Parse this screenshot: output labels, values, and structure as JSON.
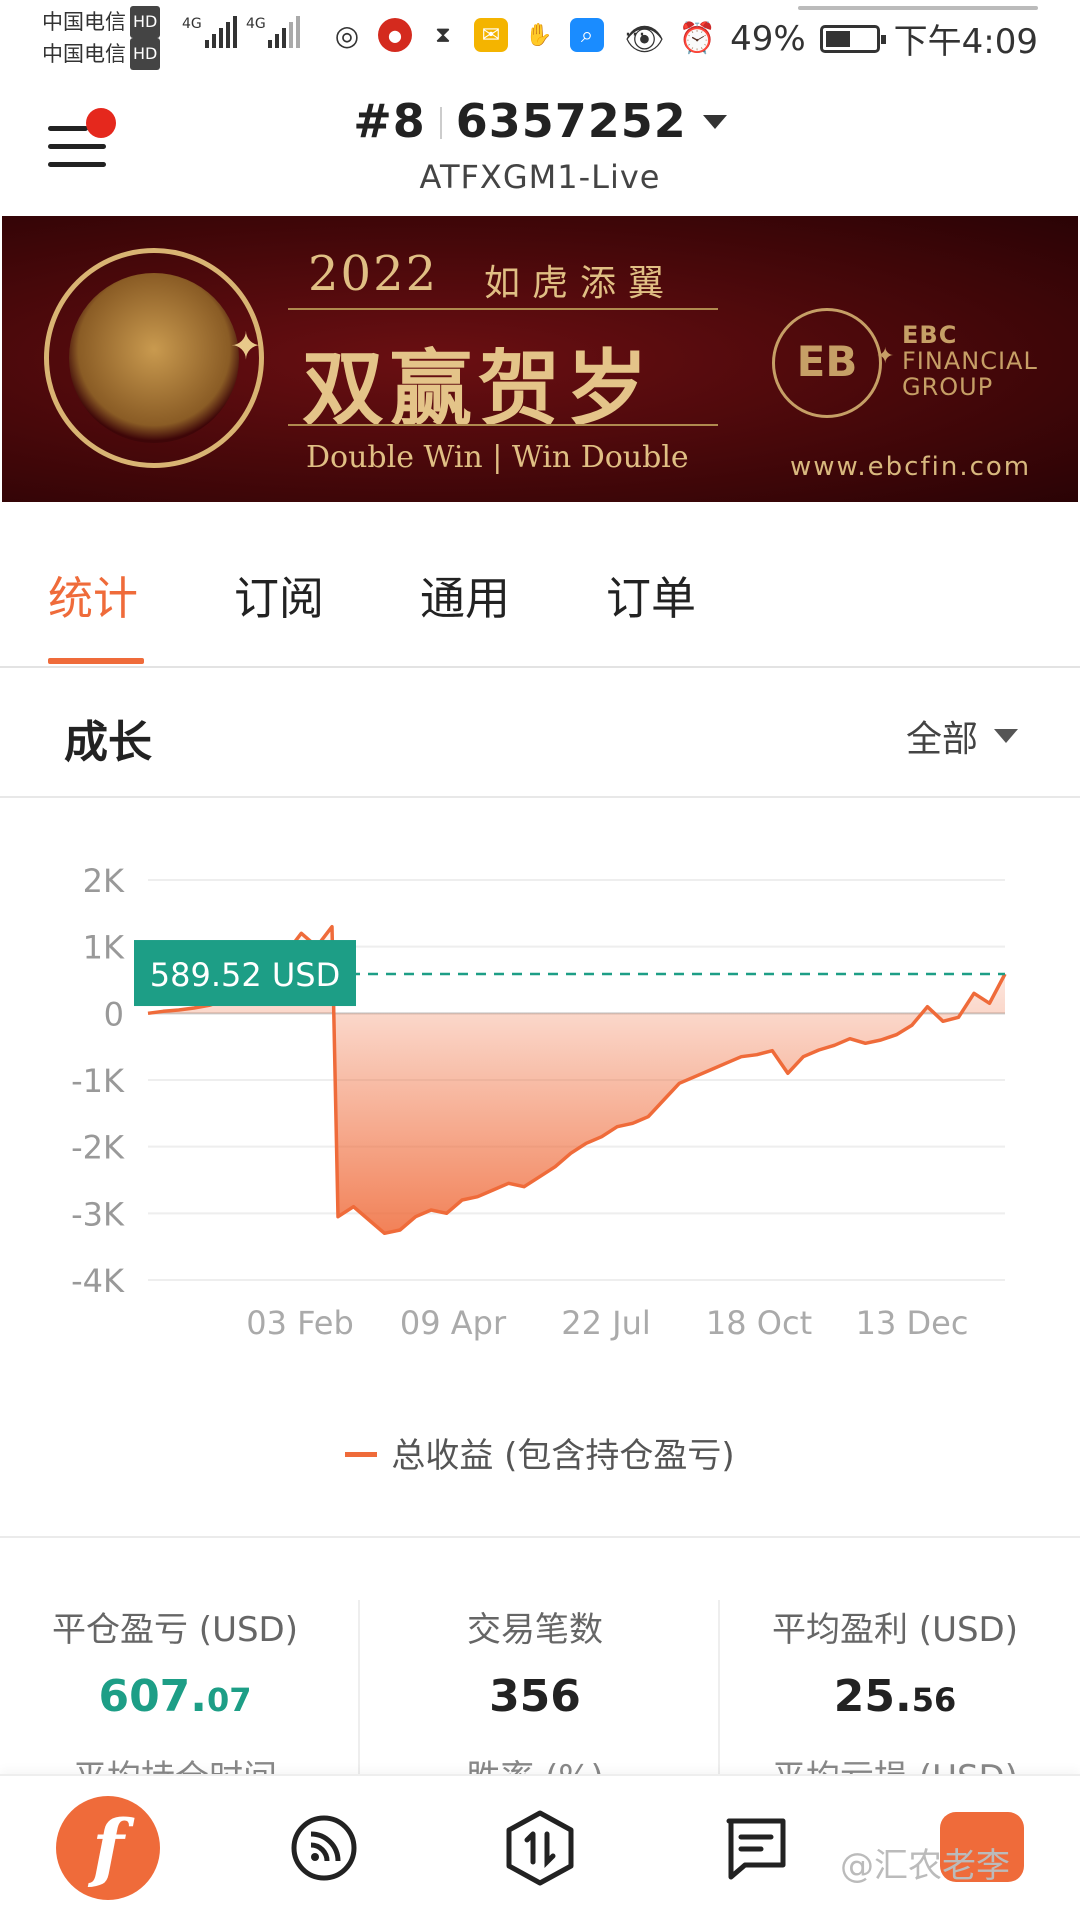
{
  "status_bar": {
    "carrier1": "中国电信",
    "carrier2": "中国电信",
    "hd_label": "HD",
    "network1": "4G",
    "network2": "4G",
    "battery_percent": "49%",
    "time": "下午4:09",
    "more": "···"
  },
  "header": {
    "rank": "#8",
    "account_id": "6357252",
    "server": "ATFXGM1-Live"
  },
  "banner": {
    "year": "2022",
    "motto": "如虎添翼",
    "headline": "双赢贺岁",
    "subtitle": "Double Win | Win Double",
    "brand_line1": "EBC",
    "brand_line2": "FINANCIAL",
    "brand_line3": "GROUP",
    "url": "www.ebcfin.com"
  },
  "tabs": [
    {
      "label": "统计",
      "active": true
    },
    {
      "label": "订阅",
      "active": false
    },
    {
      "label": "通用",
      "active": false
    },
    {
      "label": "订单",
      "active": false
    }
  ],
  "growth": {
    "title": "成长",
    "range": "全部"
  },
  "chart_data": {
    "type": "area",
    "title": "",
    "xlabel": "",
    "ylabel": "",
    "ylim": [
      -4000,
      2000
    ],
    "yticks": [
      "2K",
      "1K",
      "0",
      "-1K",
      "-2K",
      "-3K",
      "-4K"
    ],
    "xticks": [
      "03 Feb",
      "09 Apr",
      "22 Jul",
      "18 Oct",
      "13 Dec"
    ],
    "grid": true,
    "series": [
      {
        "name": "总收益 (包含持仓盈亏)",
        "values": [
          0,
          30,
          50,
          80,
          120,
          200,
          300,
          450,
          600,
          900,
          1200,
          1000,
          1300,
          -3050,
          -2900,
          -3100,
          -3300,
          -3250,
          -3050,
          -2950,
          -3000,
          -2800,
          -2750,
          -2650,
          -2550,
          -2600,
          -2450,
          -2300,
          -2100,
          -1950,
          -1850,
          -1700,
          -1650,
          -1550,
          -1300,
          -1050,
          -950,
          -850,
          -750,
          -650,
          -620,
          -560,
          -900,
          -650,
          -550,
          -480,
          -380,
          -450,
          -400,
          -320,
          -180,
          100,
          -120,
          -60,
          300,
          150,
          589.52
        ]
      }
    ],
    "current_value_label": "589.52 USD",
    "legend": "top-center below axis"
  },
  "stats": {
    "closed_pnl_label": "平仓盈亏 (USD)",
    "closed_pnl_int": "607.",
    "closed_pnl_dec": "07",
    "trades_label": "交易笔数",
    "trades_value": "356",
    "avg_profit_label": "平均盈利 (USD)",
    "avg_profit_int": "25.",
    "avg_profit_dec": "56",
    "avg_hold_label": "平均持仓时间",
    "win_rate_label": "胜率 (%)",
    "avg_loss_label": "平均亏损 (USD)"
  },
  "bottom_nav": {
    "home_glyph": "f",
    "watermark": "@汇农老李"
  },
  "colors": {
    "accent": "#ef6b3a",
    "green": "#1d9e86",
    "banner_bg": "#4a080b"
  }
}
